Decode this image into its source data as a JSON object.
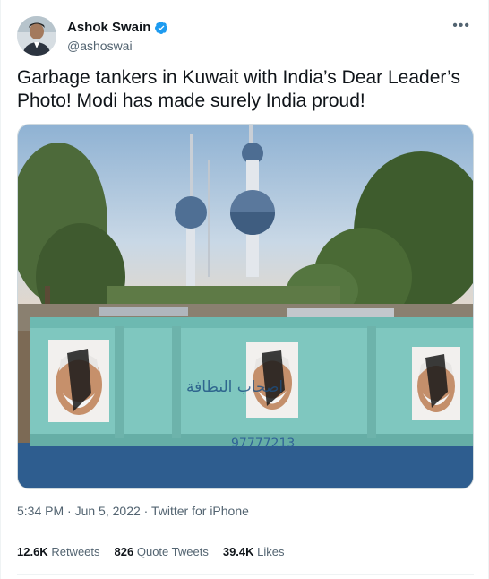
{
  "author": {
    "display_name": "Ashok Swain",
    "handle": "@ashoswai",
    "verified": true
  },
  "menu_icon": "more-horizontal-icon",
  "tweet_text": "Garbage tankers in Kuwait with India’s Dear Leader’s Photo! Modi has made surely India proud!",
  "media": {
    "arabic_text": "اصحاب النظافة",
    "phone_number": "97777213"
  },
  "meta": {
    "time": "5:34 PM",
    "separator": "·",
    "date": "Jun 5, 2022",
    "source": "Twitter for iPhone"
  },
  "stats": {
    "retweets_count": "12.6K",
    "retweets_label": "Retweets",
    "quotes_count": "826",
    "quotes_label": "Quote Tweets",
    "likes_count": "39.4K",
    "likes_label": "Likes"
  },
  "colors": {
    "verified_blue": "#1d9bf0",
    "text_primary": "#0f1419",
    "text_secondary": "#536471",
    "dumpster_teal": "#7fc7bf"
  }
}
